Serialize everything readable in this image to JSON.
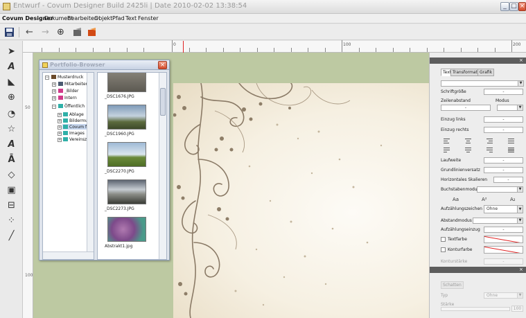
{
  "window": {
    "title": "Entwurf - Covum Designer Build 2425li | Date 2010-02-02 13:38:54"
  },
  "menu": {
    "app": "Covum Designer",
    "items": [
      "Dokument",
      "Bearbeiten",
      "Objekt",
      "Pfad",
      "Text",
      "Fenster"
    ]
  },
  "toolbar": {
    "icons": [
      "save-icon",
      "undo-icon",
      "redo-icon",
      "target-icon",
      "edit-icon",
      "edit-orange-icon"
    ]
  },
  "tools": [
    "select-icon",
    "text-frame-icon",
    "node-edit-icon",
    "zoom-icon",
    "add-shape-icon",
    "add-star-icon",
    "add-text-icon",
    "add-text-frame-icon",
    "add-diamond-icon",
    "add-image-icon",
    "layout-icon",
    "grid-icon",
    "pen-icon"
  ],
  "ruler": {
    "top_labels": [
      "0",
      "100",
      "200"
    ],
    "left_labels": [
      "50",
      "100"
    ]
  },
  "portfolio": {
    "title": "Portfolio-Browser",
    "tree": [
      {
        "label": "Musterdruck",
        "level": 0
      },
      {
        "label": "Mitarbeiter",
        "level": 1
      },
      {
        "label": "_Bilder",
        "level": 1
      },
      {
        "label": "Intern",
        "level": 1
      },
      {
        "label": "Öffentlich",
        "level": 1
      },
      {
        "label": "Ablage",
        "level": 2
      },
      {
        "label": "Bildermu",
        "level": 2
      },
      {
        "label": "Covum f",
        "level": 2
      },
      {
        "label": "Images",
        "level": 2
      },
      {
        "label": "Vereinsz",
        "level": 2
      }
    ],
    "thumbs": [
      {
        "label": "_DSC1676.JPG"
      },
      {
        "label": "_DSC1960.JPG"
      },
      {
        "label": "_DSC2270.JPG"
      },
      {
        "label": "_DSC2273.JPG"
      },
      {
        "label": "Abstrakt1.jpg"
      }
    ]
  },
  "props": {
    "tabs": [
      "Text",
      "Transformationen",
      "Grafik"
    ],
    "schriftgroesse": {
      "label": "Schriftgröße",
      "value": "-"
    },
    "zeilenabstand": {
      "label": "Zeilenabstand",
      "value": "-"
    },
    "modus": {
      "label": "Modus"
    },
    "einzug_links": {
      "label": "Einzug links",
      "value": "-"
    },
    "einzug_rechts": {
      "label": "Einzug rechts",
      "value": "-"
    },
    "laufweite": {
      "label": "Laufweite",
      "value": "-"
    },
    "grundlinienversatz": {
      "label": "Grundlinienversatz",
      "value": "-"
    },
    "horizontales_skalieren": {
      "label": "Horizontales Skalieren",
      "value": "-"
    },
    "buchstabenmodus": {
      "label": "Buchstabenmodus"
    },
    "case_letters": [
      "Aa",
      "A²",
      "A₂"
    ],
    "aufzaehlungszeichen": {
      "label": "Aufzählungszeichen",
      "value": "Ohne"
    },
    "abstandmodus": {
      "label": "Abstandmodus"
    },
    "aufzaehlungseinzug": {
      "label": "Aufzählungseinzug",
      "value": "-"
    },
    "textfarbe": {
      "label": "Textfarbe"
    },
    "konturfarbe": {
      "label": "Konturfarbe"
    },
    "konturstaerke": {
      "label": "Konturstärke",
      "value": "-"
    },
    "schatten": {
      "label": "Schatten"
    },
    "typ": {
      "label": "Typ",
      "value": "Ohne"
    },
    "staerke": {
      "label": "Stärke",
      "value": "100"
    }
  },
  "colors": {
    "canvas_bg": "#bdc9a2",
    "panel_header": "#5d5d5d",
    "accent_red": "#e02020"
  }
}
